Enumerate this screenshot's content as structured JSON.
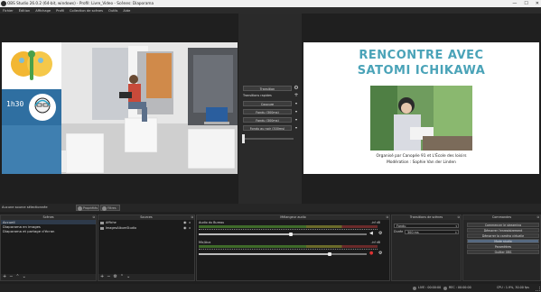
{
  "window": {
    "title": "OBS Studio 26.0.2 (64-bit, windows) - Profil: Livre_Video - Scènes: Diaporama",
    "controls": {
      "minimize": "—",
      "maximize": "☐",
      "close": "✕"
    }
  },
  "menu": [
    "Fichier",
    "Édition",
    "Affichage",
    "Profil",
    "Collection de scènes",
    "Outils",
    "Aide"
  ],
  "preview": {
    "clock_text": "1h30"
  },
  "transition_panel": {
    "transition_label": "Transition",
    "quick_label": "Transitions rapides",
    "options": [
      "Coupure",
      "Fondu (300ms)",
      "Fondu (300ms)",
      "Fondu au noir (300ms)"
    ]
  },
  "program": {
    "title_line1": "RENCONTRE AVEC",
    "title_line2": "SATOMI ICHIKAWA",
    "credit_line1": "Organisé par Canopée 91 et L'École des loisirs",
    "credit_line2": "Modération : Sophie Van der Linden"
  },
  "source_strip": {
    "no_source": "Aucune source sélectionnée",
    "properties": "Propriétés",
    "filters": "Filtres"
  },
  "scenes": {
    "title": "Scènes",
    "items": [
      "Accueil",
      "Diaporama en images",
      "Diaporama et partage d'écran"
    ]
  },
  "sources": {
    "title": "Sources",
    "items": [
      "Affiche",
      "ImagesAlbumStudio"
    ]
  },
  "mixer": {
    "title": "Mélangeur audio",
    "channels": [
      {
        "name": "Audio du Bureau",
        "db": "-inf dB",
        "volume": 0.55
      },
      {
        "name": "Mic/Aux",
        "db": "-inf dB",
        "volume": 0.78
      }
    ]
  },
  "transitions": {
    "title": "Transitions de scènes",
    "type": "Fondu",
    "duration_label": "Durée",
    "duration": "300 ms"
  },
  "controls": {
    "title": "Commandes",
    "buttons": [
      "Commencer le streaming",
      "Démarrer l'enregistrement",
      "Démarrer la caméra virtuelle",
      "Mode studio",
      "Paramètres",
      "Quitter OBS"
    ],
    "active_index": 3
  },
  "status": {
    "live": "LIVE : 00:00:00",
    "rec": "REC : 00:00:00",
    "cpu": "CPU : 1.9%, 30.00 fps"
  },
  "colors": {
    "accent_title": "#4aa3b8",
    "active_button": "#566980"
  }
}
